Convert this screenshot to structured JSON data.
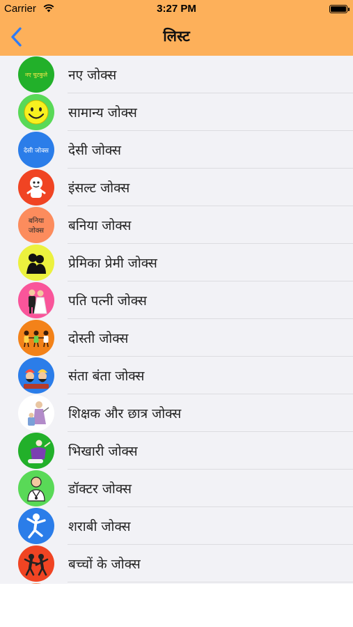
{
  "status_bar": {
    "carrier": "Carrier",
    "time": "3:27 PM",
    "battery_level": 1.0
  },
  "nav": {
    "title": "लिस्ट",
    "back_icon": "chevron-left-icon"
  },
  "colors": {
    "header": "#fdb05a",
    "back_tint": "#2f7bf5",
    "list_bg": "#f2f2f6"
  },
  "items": [
    {
      "label": "नए जोक्स",
      "icon": "new-jokes-icon",
      "icon_text": "नए चुटकुले",
      "color": "#22b02a"
    },
    {
      "label": "सामान्य जोक्स",
      "icon": "smiley-icon",
      "color": "#59d957"
    },
    {
      "label": "देसी जोक्स",
      "icon": "desi-jokes-icon",
      "icon_text": "देसी जोक्स",
      "color": "#2b7de9"
    },
    {
      "label": "इंसल्ट जोक्स",
      "icon": "insult-icon",
      "color": "#f04423"
    },
    {
      "label": "बनिया जोक्स",
      "icon": "baniya-jokes-icon",
      "icon_text": "बनिया जोक्स",
      "color": "#fc8c5d"
    },
    {
      "label": "प्रेमिका प्रेमी जोक्स",
      "icon": "couple-silhouette-icon",
      "color": "#ecf13e"
    },
    {
      "label": "पति पत्नी जोक्स",
      "icon": "bride-groom-icon",
      "color": "#f9559a"
    },
    {
      "label": "दोस्ती जोक्स",
      "icon": "friends-icon",
      "color": "#f38219"
    },
    {
      "label": "संता बंता जोक्स",
      "icon": "santa-banta-icon",
      "color": "#2b7de9"
    },
    {
      "label": "शिक्षक और छात्र जोक्स",
      "icon": "teacher-student-icon",
      "color": "#ffffff"
    },
    {
      "label": "भिखारी जोक्स",
      "icon": "beggar-icon",
      "color": "#22b02a"
    },
    {
      "label": "डॉक्टर जोक्स",
      "icon": "doctor-icon",
      "color": "#59d957"
    },
    {
      "label": "शराबी जोक्स",
      "icon": "drunkard-icon",
      "color": "#2b7de9"
    },
    {
      "label": "बच्चों के जोक्स",
      "icon": "kids-icon",
      "color": "#f04423"
    },
    {
      "label": "",
      "icon": "next-item-icon",
      "color": "#fc8c5d"
    }
  ]
}
